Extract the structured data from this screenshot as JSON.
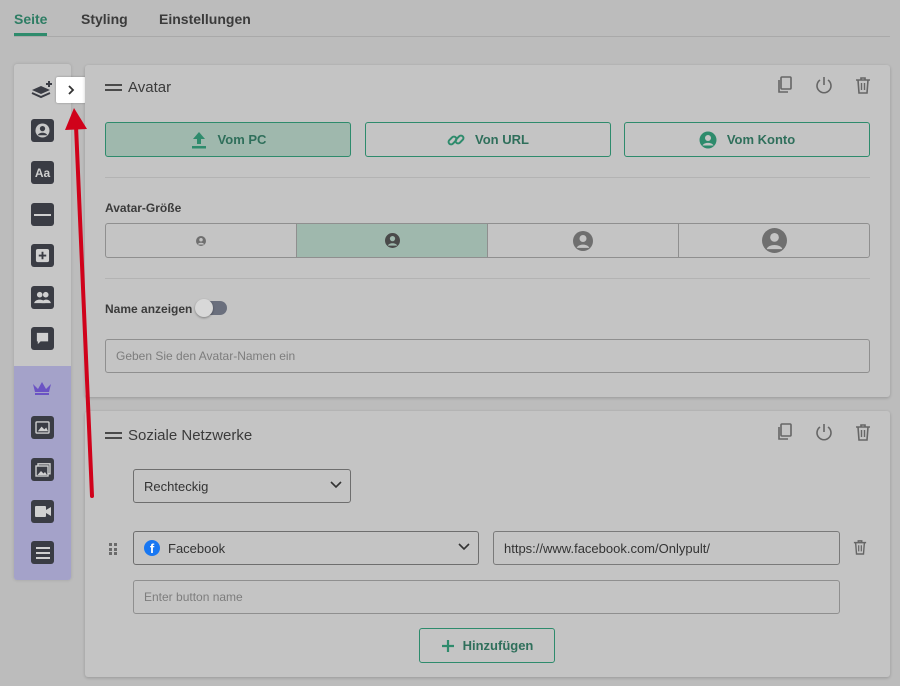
{
  "tabs": [
    {
      "label": "Seite",
      "active": true
    },
    {
      "label": "Styling",
      "active": false
    },
    {
      "label": "Einstellungen",
      "active": false
    }
  ],
  "toolbar": {
    "tools": [
      {
        "name": "layers-add-icon"
      },
      {
        "name": "avatar-icon"
      },
      {
        "name": "text-icon",
        "glyph": "Aa"
      },
      {
        "name": "divider-icon"
      },
      {
        "name": "add-block-icon"
      },
      {
        "name": "users-icon"
      },
      {
        "name": "comment-icon"
      }
    ],
    "premium_tools": [
      {
        "name": "crown-icon"
      },
      {
        "name": "image-icon"
      },
      {
        "name": "gallery-icon"
      },
      {
        "name": "video-icon"
      },
      {
        "name": "list-icon"
      }
    ],
    "expand_icon": "chevron-right-icon"
  },
  "avatar_card": {
    "title": "Avatar",
    "sources": [
      {
        "label": "Vom PC",
        "icon": "upload-icon",
        "active": true
      },
      {
        "label": "Von URL",
        "icon": "link-icon",
        "active": false
      },
      {
        "label": "Vom Konto",
        "icon": "account-icon",
        "active": false
      }
    ],
    "size_label": "Avatar-Größe",
    "size_selected_index": 1,
    "show_name_label": "Name anzeigen",
    "show_name_enabled": false,
    "name_placeholder": "Geben Sie den Avatar-Namen ein",
    "name_value": ""
  },
  "social_card": {
    "title": "Soziale Netzwerke",
    "shape_select": "Rechteckig",
    "network_select": "Facebook",
    "network_url": "https://www.facebook.com/Onlypult/",
    "button_name_placeholder": "Enter button name",
    "button_name_value": "",
    "add_label": "Hinzufügen"
  },
  "colors": {
    "accent": "#2e8b6c",
    "active_fill": "#9fb8ad",
    "premium": "#a4a2c9",
    "annotation_arrow": "#d0021b"
  }
}
